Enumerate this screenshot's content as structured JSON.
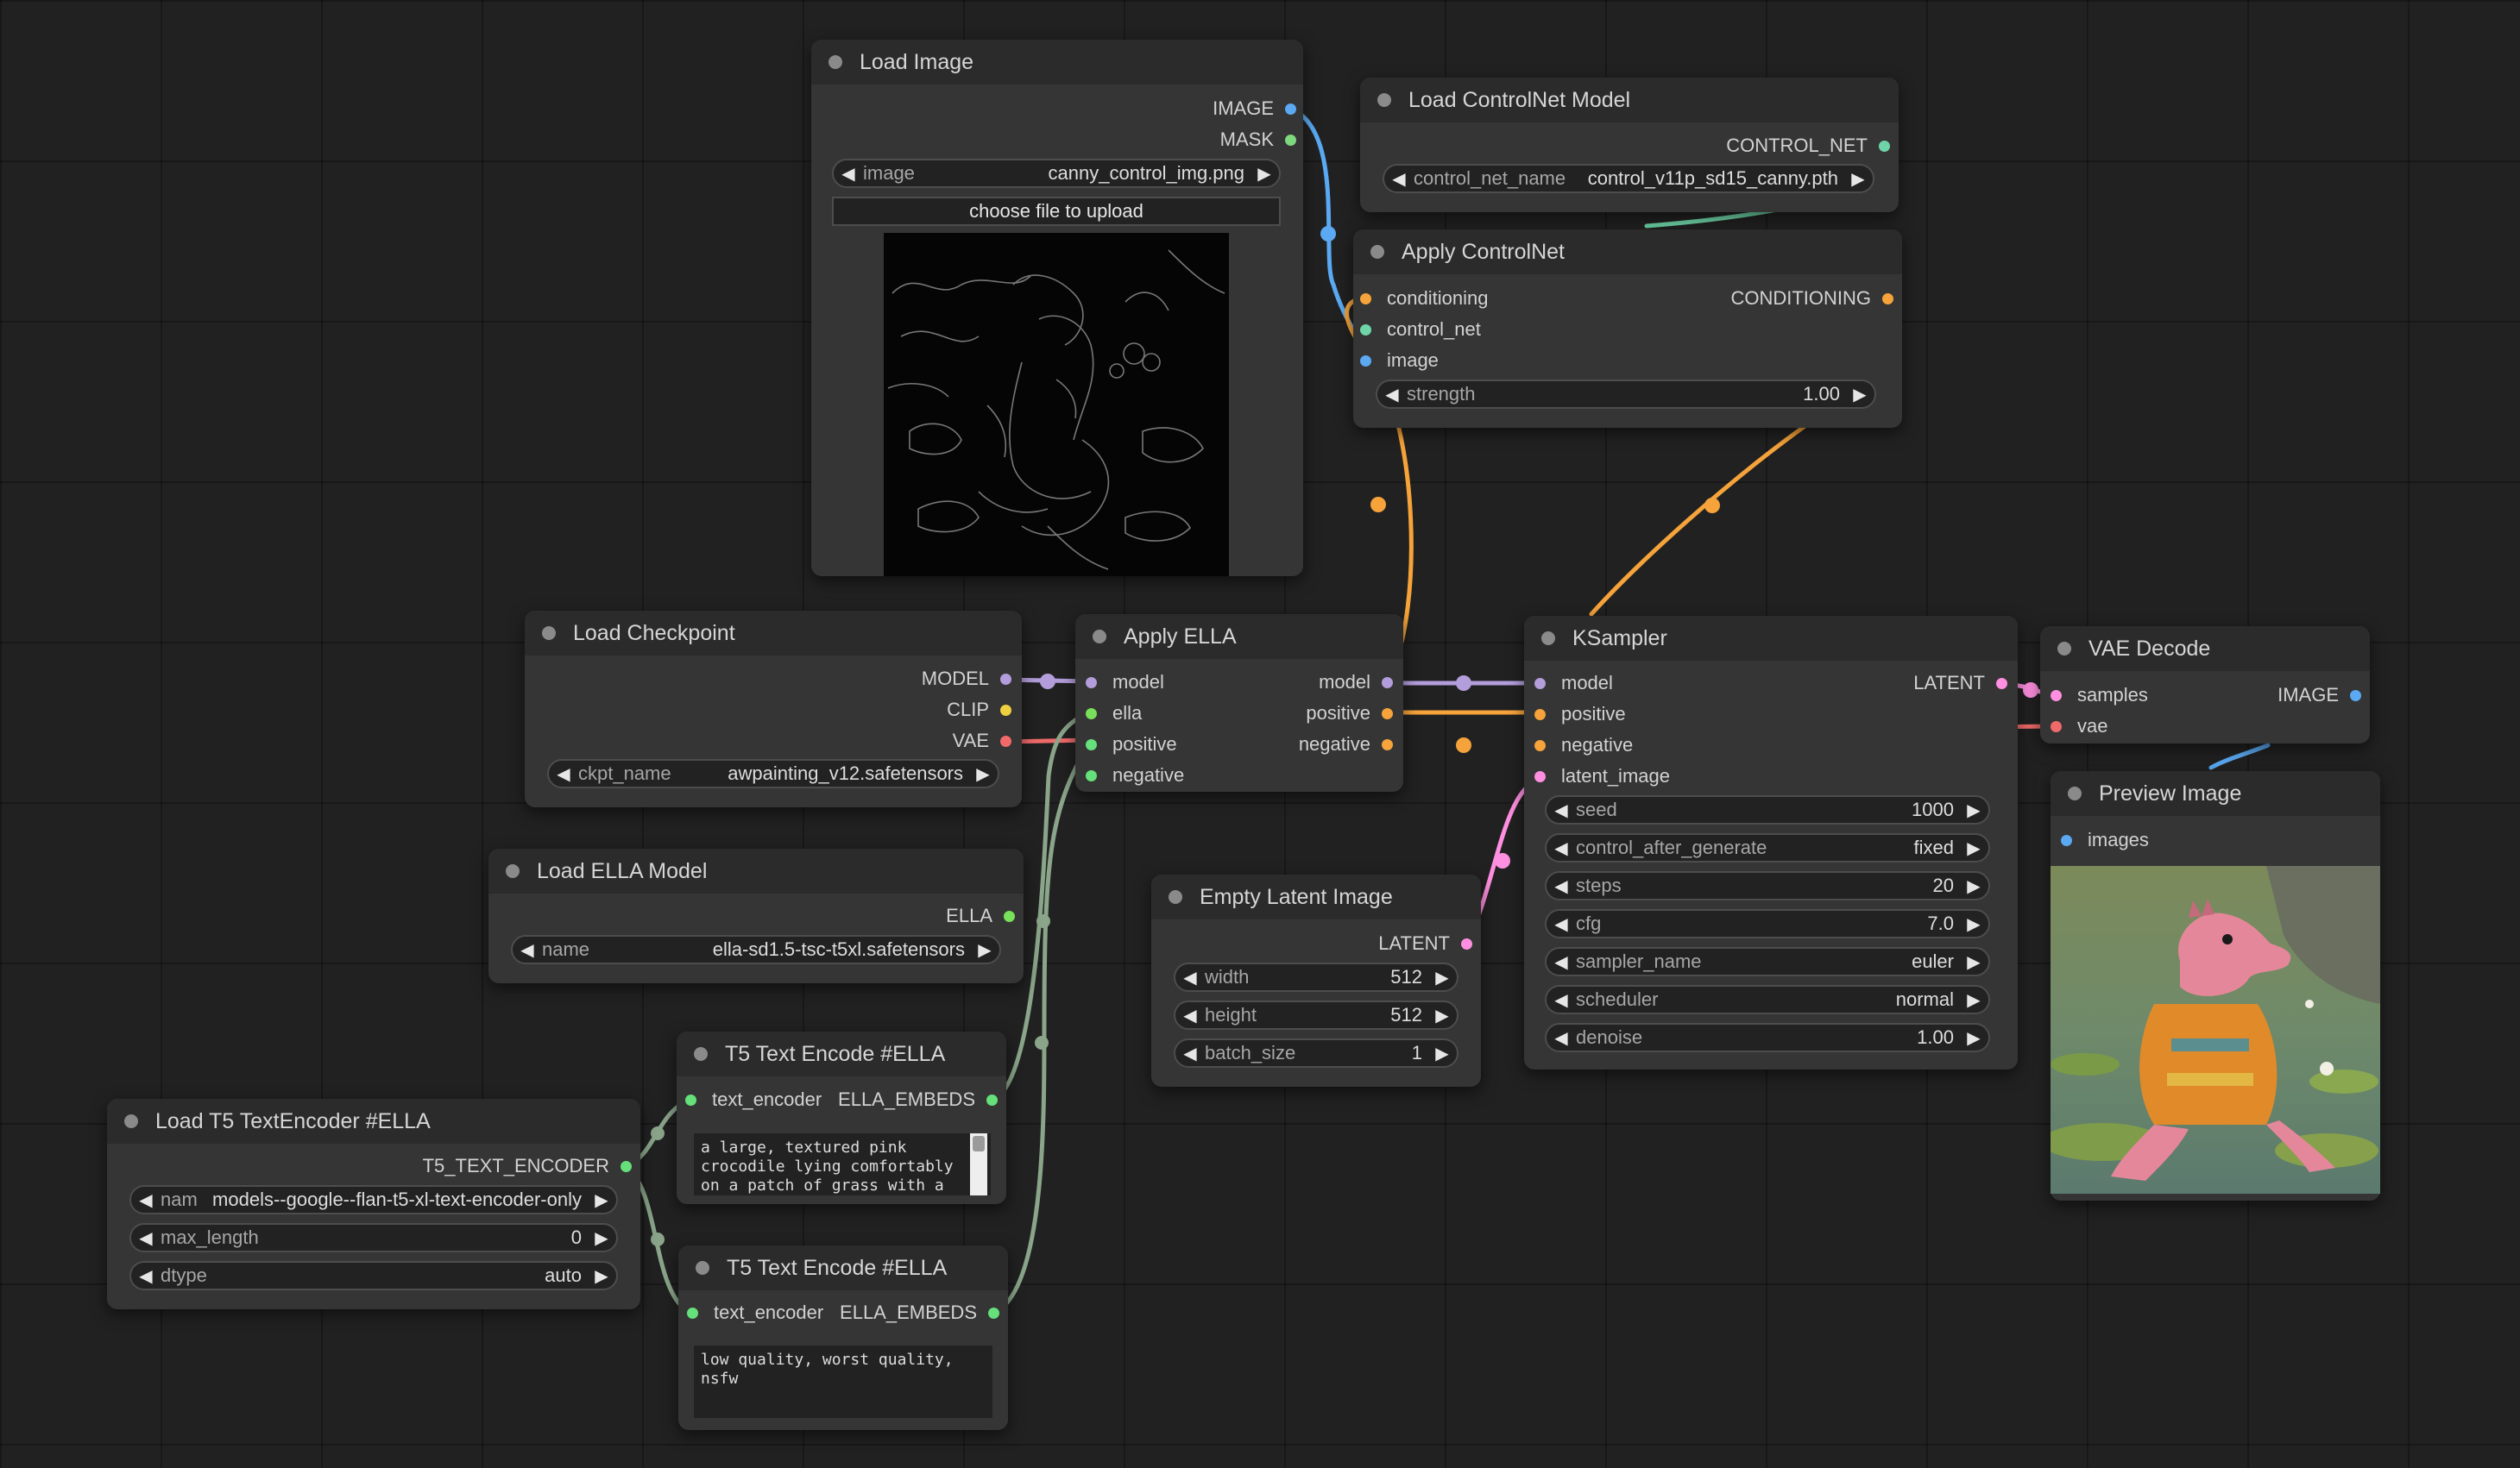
{
  "colors": {
    "image": "#5aa9f2",
    "mask": "#7ed87e",
    "control_net": "#6fd5a8",
    "conditioning": "#f5a33a",
    "model": "#b39ddb",
    "clip": "#f0d040",
    "vae": "#f06a6a",
    "ella": "#78e05a",
    "latent": "#ff8fe0",
    "t5": "#66e07a",
    "embeds": "#66e07a"
  },
  "nodes": {
    "load_image": {
      "title": "Load Image",
      "outputs": [
        "IMAGE",
        "MASK"
      ],
      "image_label": "image",
      "image_value": "canny_control_img.png",
      "upload_label": "choose file to upload"
    },
    "load_controlnet": {
      "title": "Load ControlNet Model",
      "output": "CONTROL_NET",
      "widget_label": "control_net_name",
      "widget_value": "control_v11p_sd15_canny.pth"
    },
    "apply_controlnet": {
      "title": "Apply ControlNet",
      "inputs": [
        "conditioning",
        "control_net",
        "image"
      ],
      "output": "CONDITIONING",
      "strength_label": "strength",
      "strength_value": "1.00"
    },
    "load_checkpoint": {
      "title": "Load Checkpoint",
      "outputs": [
        "MODEL",
        "CLIP",
        "VAE"
      ],
      "widget_label": "ckpt_name",
      "widget_value": "awpainting_v12.safetensors"
    },
    "apply_ella": {
      "title": "Apply ELLA",
      "inputs": [
        "model",
        "ella",
        "positive",
        "negative"
      ],
      "outputs": [
        "model",
        "positive",
        "negative"
      ]
    },
    "ksampler": {
      "title": "KSampler",
      "inputs": [
        "model",
        "positive",
        "negative",
        "latent_image"
      ],
      "output": "LATENT",
      "widgets": [
        {
          "label": "seed",
          "value": "1000"
        },
        {
          "label": "control_after_generate",
          "value": "fixed"
        },
        {
          "label": "steps",
          "value": "20"
        },
        {
          "label": "cfg",
          "value": "7.0"
        },
        {
          "label": "sampler_name",
          "value": "euler"
        },
        {
          "label": "scheduler",
          "value": "normal"
        },
        {
          "label": "denoise",
          "value": "1.00"
        }
      ]
    },
    "vae_decode": {
      "title": "VAE Decode",
      "inputs": [
        "samples",
        "vae"
      ],
      "output": "IMAGE"
    },
    "preview_image": {
      "title": "Preview Image",
      "input": "images"
    },
    "load_ella_model": {
      "title": "Load ELLA Model",
      "output": "ELLA",
      "widget_label": "name",
      "widget_value": "ella-sd1.5-tsc-t5xl.safetensors"
    },
    "empty_latent": {
      "title": "Empty Latent Image",
      "output": "LATENT",
      "widgets": [
        {
          "label": "width",
          "value": "512"
        },
        {
          "label": "height",
          "value": "512"
        },
        {
          "label": "batch_size",
          "value": "1"
        }
      ]
    },
    "t5_encode_pos": {
      "title": "T5 Text Encode #ELLA",
      "input": "text_encoder",
      "output": "ELLA_EMBEDS",
      "text": "a large, textured pink\ncrocodile lying comfortably\non a patch of grass with a"
    },
    "t5_encode_neg": {
      "title": "T5 Text Encode #ELLA",
      "input": "text_encoder",
      "output": "ELLA_EMBEDS",
      "text": "low quality, worst quality,\nnsfw"
    },
    "load_t5": {
      "title": "Load T5 TextEncoder #ELLA",
      "output": "T5_TEXT_ENCODER",
      "widgets": [
        {
          "label": "nam",
          "value": "models--google--flan-t5-xl-text-encoder-only"
        },
        {
          "label": "max_length",
          "value": "0"
        },
        {
          "label": "dtype",
          "value": "auto"
        }
      ]
    }
  },
  "icons": {
    "arrow_left": "◀",
    "arrow_right": "▶"
  }
}
